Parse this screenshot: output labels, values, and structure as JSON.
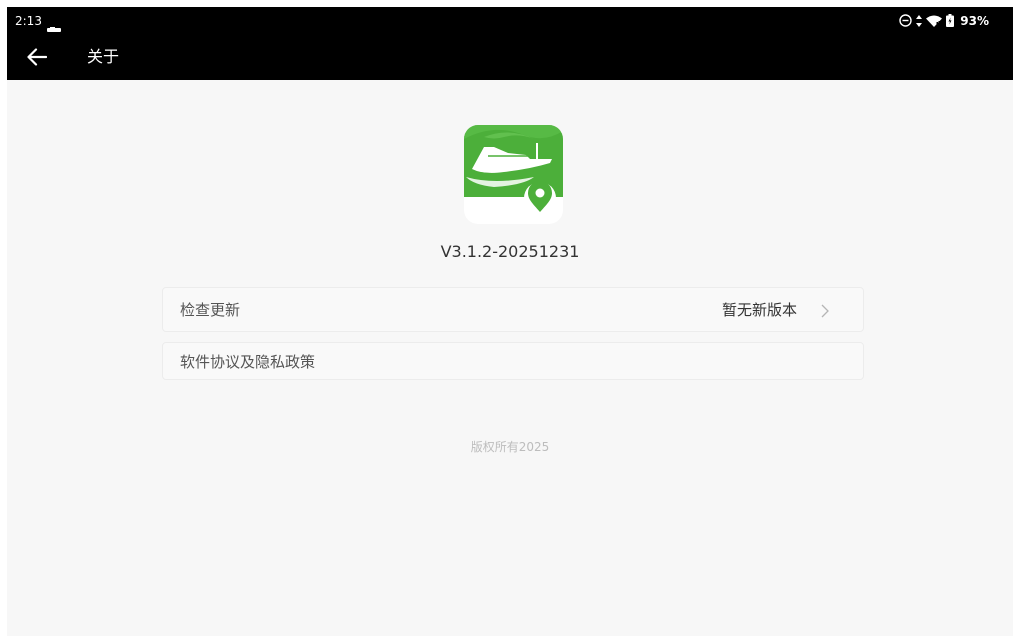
{
  "status_bar": {
    "time": "2:13",
    "battery": "93%",
    "icons": [
      "notification-icon",
      "do-not-disturb-icon",
      "data-arrows-icon",
      "wifi-icon",
      "battery-icon"
    ]
  },
  "app_bar": {
    "back_icon": "arrow-left-icon",
    "title": "关于"
  },
  "about": {
    "logo_icon": "boat-location-app-icon",
    "version": "V3.1.2-20251231",
    "items": [
      {
        "label": "检查更新",
        "value": "暂无新版本",
        "icon": "chevron-right-icon"
      },
      {
        "label": "软件协议及隐私政策"
      }
    ],
    "copyright": "版权所有2025"
  },
  "colors": {
    "bar": "#000000",
    "background": "#f7f7f7",
    "logo_green": "#4caf3a",
    "text_dark": "#333333",
    "text_muted": "#bdbdbd"
  }
}
